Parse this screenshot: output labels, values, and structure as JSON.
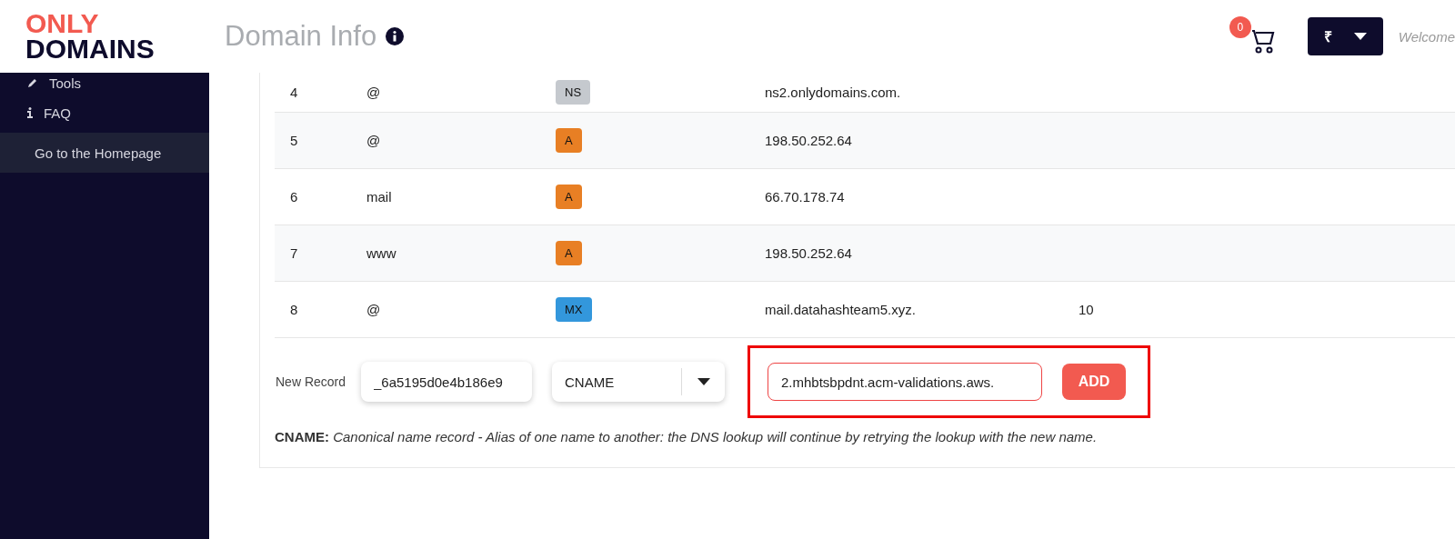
{
  "logo": {
    "top": "ONLY",
    "bottom": "DOMAINS"
  },
  "header": {
    "title": "Domain Info",
    "cart_count": "0",
    "currency": "₹",
    "welcome": "Welcome"
  },
  "sidebar": {
    "items": [
      {
        "label": "Tools",
        "kind": "tool",
        "selected": false
      },
      {
        "label": "FAQ",
        "kind": "help",
        "selected": false
      },
      {
        "label": "Go to the Homepage",
        "kind": "link",
        "selected": true
      }
    ]
  },
  "records": [
    {
      "index": "4",
      "name": "@",
      "type": "NS",
      "color": "#c5c9ce",
      "value": "ns2.onlydomains.com."
    },
    {
      "index": "5",
      "name": "@",
      "type": "A",
      "color": "#e87f24",
      "value": "198.50.252.64"
    },
    {
      "index": "6",
      "name": "mail",
      "type": "A",
      "color": "#e87f24",
      "value": "66.70.178.74"
    },
    {
      "index": "7",
      "name": "www",
      "type": "A",
      "color": "#e87f24",
      "value": "198.50.252.64"
    },
    {
      "index": "8",
      "name": "@",
      "type": "MX",
      "color": "#3397dc",
      "value": "mail.datahashteam5.xyz.",
      "priority": "10"
    }
  ],
  "new_record": {
    "label": "New Record",
    "name_value": "_6a5195d0e4b186e9",
    "type_value": "CNAME",
    "content_value": "2.mhbtsbpdnt.acm-validations.aws.",
    "add_button": "ADD",
    "highlighted": true
  },
  "description": {
    "term": "CNAME:",
    "text": "Canonical name record - Alias of one name to another: the DNS lookup will continue by retrying the lookup with the new name."
  }
}
